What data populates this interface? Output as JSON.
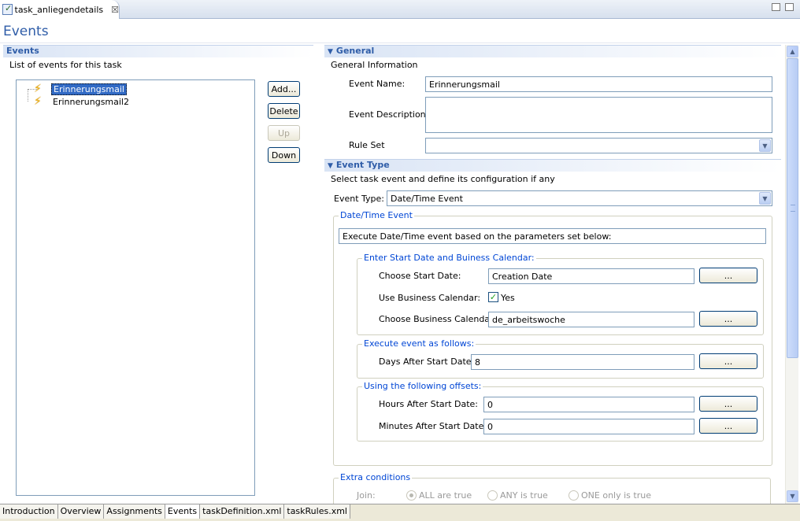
{
  "editor_tab": {
    "title": "task_anliegendetails",
    "close": "☒"
  },
  "page_title": "Events",
  "events_section": {
    "title": "Events",
    "description": "List of events for this task",
    "items": [
      {
        "label": "Erinnerungsmail",
        "selected": true
      },
      {
        "label": "Erinnerungsmail2",
        "selected": false
      }
    ],
    "buttons": {
      "add": "Add...",
      "delete": "Delete",
      "up": "Up",
      "down": "Down"
    }
  },
  "general": {
    "title": "General",
    "description": "General Information",
    "event_name_label": "Event Name:",
    "event_name_value": "Erinnerungsmail",
    "event_description_label": "Event Description:",
    "event_description_value": "",
    "rule_set_label": "Rule Set",
    "rule_set_value": ""
  },
  "event_type": {
    "title": "Event Type",
    "description": "Select task event and define its configuration if any",
    "type_label": "Event Type:",
    "type_value": "Date/Time Event",
    "datetime_group": {
      "title": "Date/Time Event",
      "info": "Execute Date/Time event based on the parameters set below:",
      "start_group": {
        "title": "Enter Start Date and Buiness Calendar:",
        "start_date_label": "Choose Start Date:",
        "start_date_value": "Creation Date",
        "use_calendar_label": "Use Business Calendar:",
        "use_calendar_checked": true,
        "use_calendar_text": "Yes",
        "calendar_label": "Choose Business Calendar:",
        "calendar_value": "de_arbeitswoche",
        "browse": "..."
      },
      "execute_group": {
        "title": "Execute event as follows:",
        "days_label": "Days After Start Date:",
        "days_value": "8",
        "browse": "..."
      },
      "offsets_group": {
        "title": "Using the following offsets:",
        "hours_label": "Hours After Start Date:",
        "hours_value": "0",
        "minutes_label": "Minutes After Start Date:",
        "minutes_value": "0",
        "browse": "..."
      }
    }
  },
  "extra_conditions": {
    "title": "Extra conditions",
    "join_label": "Join:",
    "options": [
      {
        "label": "ALL are true",
        "selected": true
      },
      {
        "label": "ANY is true",
        "selected": false
      },
      {
        "label": "ONE only is true",
        "selected": false
      }
    ]
  },
  "page_tabs": [
    {
      "label": "Introduction",
      "active": false
    },
    {
      "label": "Overview",
      "active": false
    },
    {
      "label": "Assignments",
      "active": false
    },
    {
      "label": "Events",
      "active": true
    },
    {
      "label": "taskDefinition.xml",
      "active": false
    },
    {
      "label": "taskRules.xml",
      "active": false
    }
  ],
  "icons": [
    "task-file-icon",
    "close-icon",
    "minimize-icon",
    "maximize-icon",
    "lightning-icon",
    "collapse-arrow-icon",
    "dropdown-arrow-icon",
    "scroll-up-icon",
    "scroll-down-icon"
  ]
}
